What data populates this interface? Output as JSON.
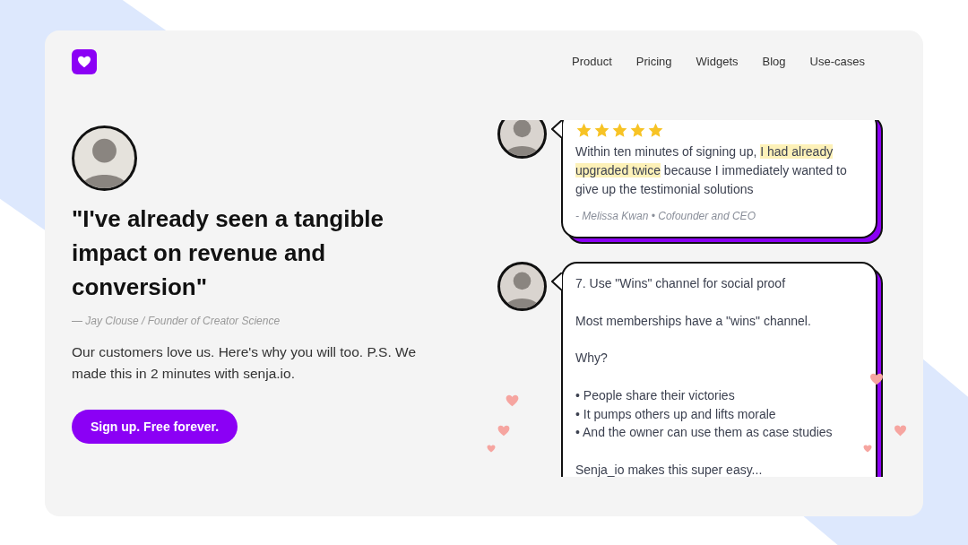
{
  "nav": {
    "links": [
      "Product",
      "Pricing",
      "Widgets",
      "Blog",
      "Use-cases"
    ]
  },
  "hero": {
    "quote": "\"I've already seen a tangible impact on revenue and conversion\"",
    "attribution": "— Jay Clouse / Founder of Creator Science",
    "description": "Our customers love us. Here's why you will too. P.S. We made this in 2 minutes with senja.io.",
    "cta": "Sign up. Free forever."
  },
  "testimonials": [
    {
      "kind": "rated",
      "stars": 5,
      "segments": [
        {
          "text": "Within ten minutes of signing up, ",
          "highlighted": false
        },
        {
          "text": "I had already upgraded twice",
          "highlighted": true
        },
        {
          "text": " because I immediately wanted to give up the testimonial solutions",
          "highlighted": false
        }
      ],
      "author": "- Melissa Kwan • Cofounder and CEO"
    },
    {
      "kind": "post",
      "paragraphs": [
        [
          "7. Use \"Wins\" channel for social proof"
        ],
        [
          "Most memberships have a \"wins\" channel."
        ],
        [
          "Why?"
        ],
        [
          "• People share their victories",
          "• It pumps others up and lifts morale",
          "• And the owner can use them as case studies"
        ],
        [
          "Senja_io makes this super easy..."
        ]
      ]
    }
  ]
}
